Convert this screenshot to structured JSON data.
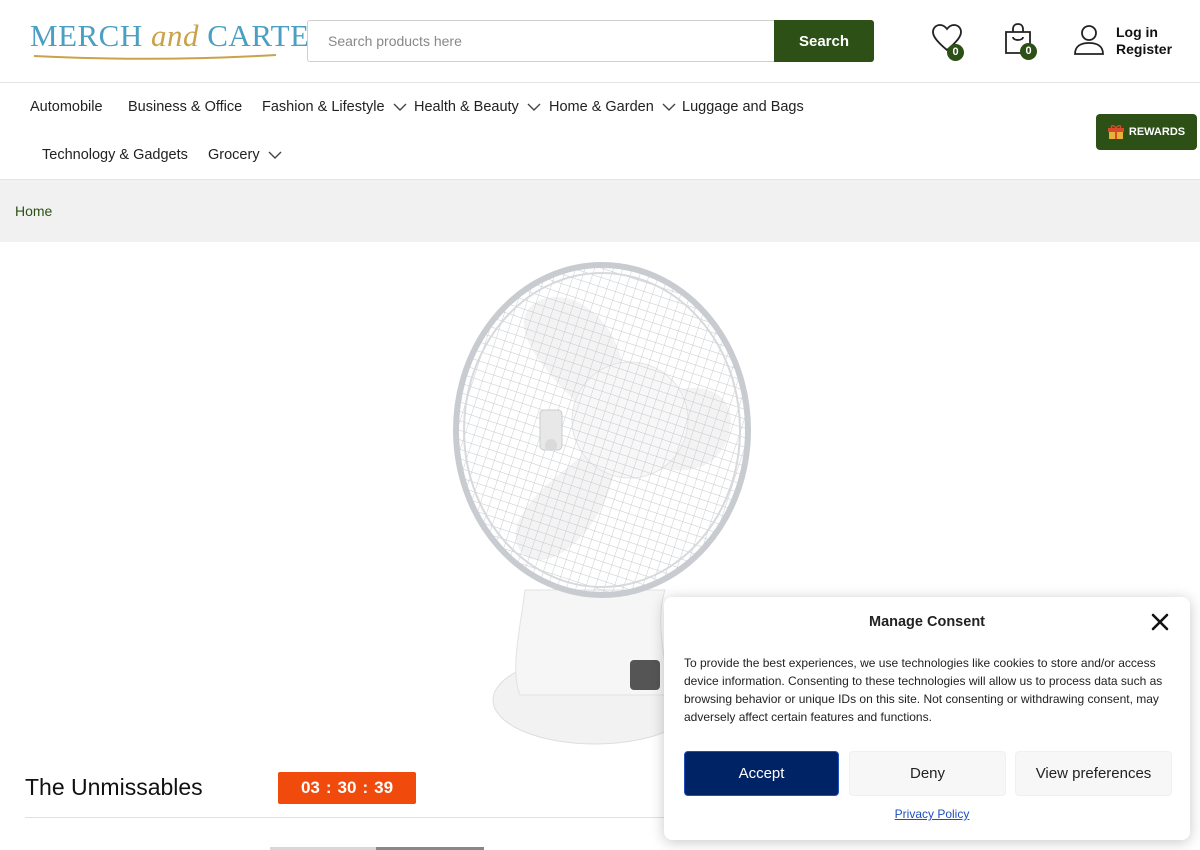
{
  "brand": {
    "logo_part1": "MERCH ",
    "logo_and": "and",
    "logo_part2": " CARTER"
  },
  "search": {
    "placeholder": "Search products here",
    "button_label": "Search"
  },
  "header": {
    "wishlist_count": "0",
    "cart_count": "0",
    "login_label": "Log in",
    "register_label": "Register"
  },
  "nav": {
    "items": [
      {
        "label": "Automobile"
      },
      {
        "label": "Business & Office"
      },
      {
        "label": "Fashion & Lifestyle"
      },
      {
        "label": "Health & Beauty"
      },
      {
        "label": "Home & Garden"
      },
      {
        "label": "Luggage and Bags"
      },
      {
        "label": "Technology & Gadgets"
      },
      {
        "label": "Grocery"
      }
    ],
    "rewards_label": "REWARDS"
  },
  "breadcrumb": {
    "home": "Home"
  },
  "deals": {
    "title": "The Unmissables",
    "timer_hours": "03",
    "timer_minutes": "30",
    "timer_seconds": "39",
    "timer_sep": ":"
  },
  "consent": {
    "title": "Manage Consent",
    "text": "To provide the best experiences, we use technologies like cookies to store and/or access device information. Consenting to these technologies will allow us to process data such as browsing behavior or unique IDs on this site. Not consenting or withdrawing consent, may adversely affect certain features and functions.",
    "accept_label": "Accept",
    "deny_label": "Deny",
    "preferences_label": "View preferences",
    "privacy_label": "Privacy Policy"
  },
  "colors": {
    "brand_green": "#2d5016",
    "timer_orange": "#f04a0c",
    "accept_blue": "#002366"
  }
}
